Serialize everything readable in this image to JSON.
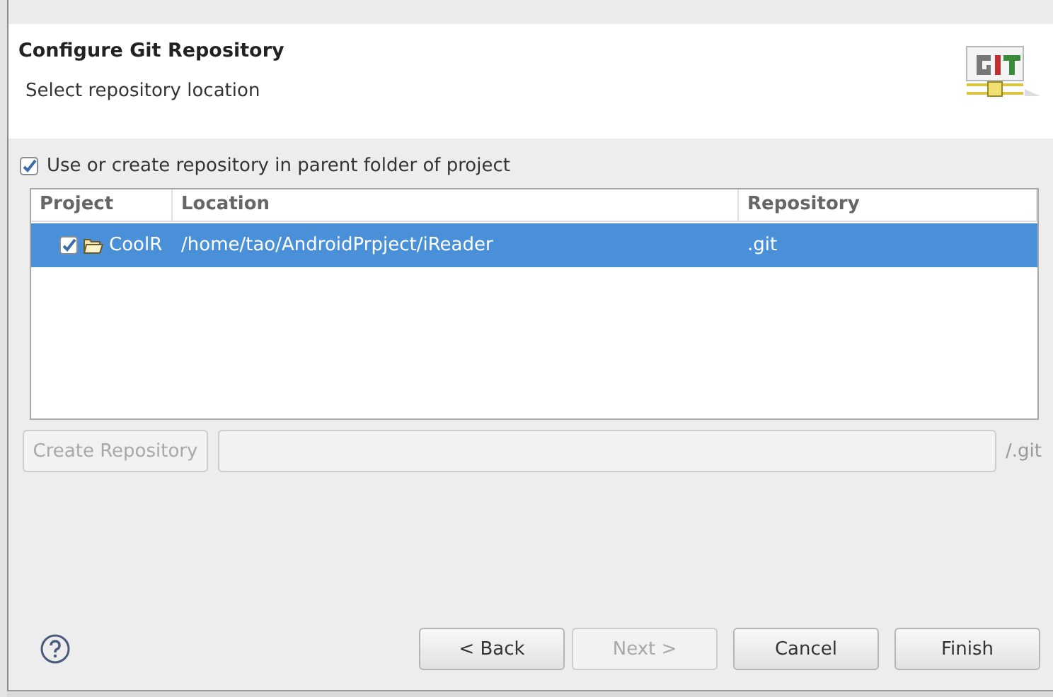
{
  "dialog": {
    "title": "Configure Git Repository",
    "subtitle": "Select repository location"
  },
  "use_parent_option": {
    "label": "Use or create repository in parent folder of project",
    "checked": true
  },
  "table": {
    "columns": [
      "Project",
      "Location",
      "Repository"
    ],
    "rows": [
      {
        "checked": true,
        "selected": true,
        "cells": [
          "CoolR",
          "/home/tao/AndroidPrpject/iReader",
          ".git"
        ]
      }
    ]
  },
  "create": {
    "button": {
      "label": "Create Repository",
      "disabled": true
    },
    "path_field": {
      "disabled": true
    },
    "suffix": "/.git"
  },
  "buttons": [
    {
      "label": "< Back",
      "disabled": false
    },
    {
      "label": "Next >",
      "disabled": true
    },
    {
      "label": "Cancel",
      "disabled": false
    },
    {
      "label": "Finish",
      "disabled": false
    }
  ]
}
